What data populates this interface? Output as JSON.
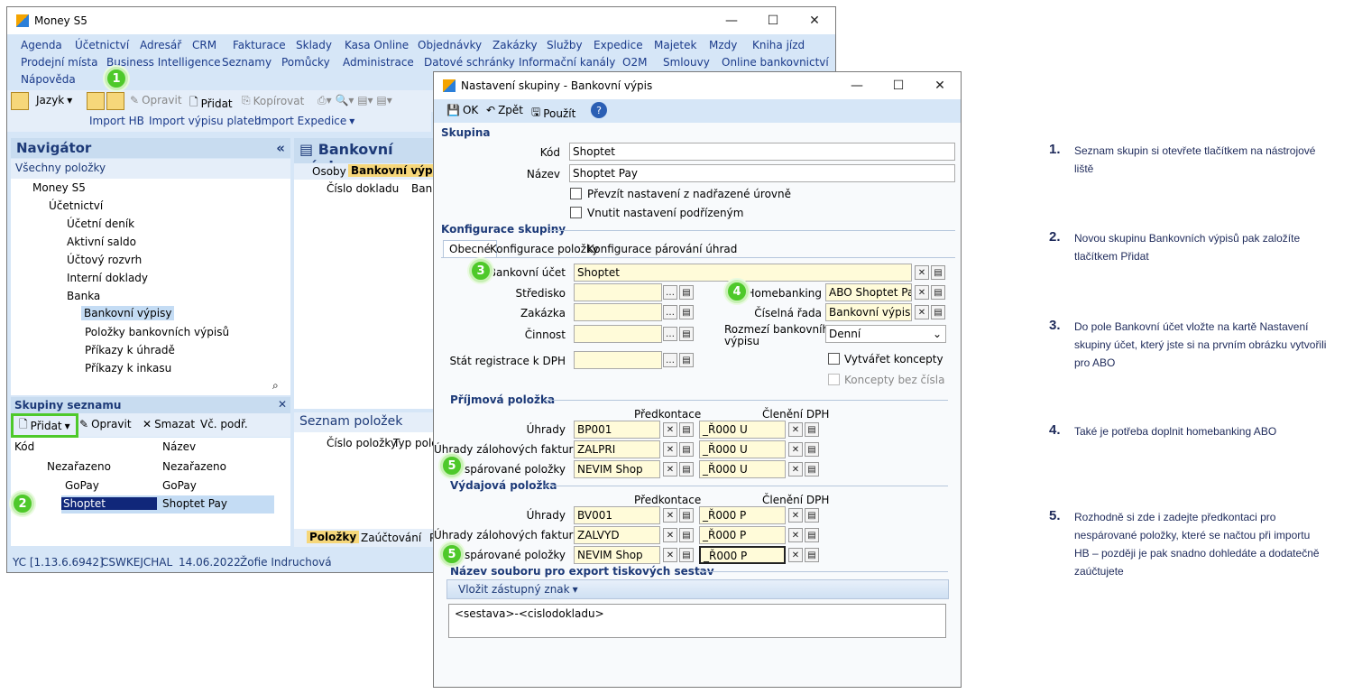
{
  "main": {
    "title": "Money S5",
    "menu_row1": [
      "Agenda",
      "Účetnictví",
      "Adresář",
      "CRM",
      "Fakturace",
      "Sklady",
      "Kasa Online",
      "Objednávky",
      "Zakázky",
      "Služby",
      "Expedice",
      "Majetek",
      "Mzdy",
      "Kniha jízd"
    ],
    "menu_row2": [
      "Prodejní místa",
      "Business Intelligence",
      "Seznamy",
      "Pomůcky",
      "Administrace",
      "Datové schránky",
      "Informační kanály",
      "O2M",
      "Smlouvy",
      "Online bankovnictví"
    ],
    "menu_row3": [
      "Nápověda"
    ],
    "toolbar": {
      "jazyk": "Jazyk",
      "opravit": "Opravit",
      "pridat": "Přidat",
      "kopirovat": "Kopírovat"
    },
    "import_bar": [
      "Import HB",
      "Import výpisu plateb",
      "Import Expedice"
    ],
    "navigator": {
      "title": "Navigátor",
      "all": "Všechny položky",
      "tree": [
        "Money S5",
        "Účetnictví",
        "Účetní deník",
        "Aktivní saldo",
        "Účtový rozvrh",
        "Interní doklady",
        "Banka",
        "Bankovní výpisy",
        "Položky bankovních výpisů",
        "Příkazy k úhradě",
        "Příkazy k inkasu"
      ]
    },
    "groups": {
      "title": "Skupiny seznamu",
      "pridat": "Přidat",
      "opravit": "Opravit",
      "smazat": "Smazat",
      "vc_podr": "Vč. podř.",
      "col_kod": "Kód",
      "col_nazev": "Název",
      "rows": [
        {
          "kod": "Nezařazeno",
          "nazev": "Nezařazeno"
        },
        {
          "kod": "GoPay",
          "nazev": "GoPay"
        },
        {
          "kod": "Shoptet",
          "nazev": "Shoptet Pay"
        }
      ]
    },
    "content": {
      "title": "Bankovní výpisy",
      "tabs": [
        "Osoby",
        "Bankovní výpisy"
      ],
      "col1": "Číslo dokladu",
      "col2": "Bank",
      "sub_title": "Seznam položek",
      "sub_col1": "Číslo položky",
      "sub_col2": "Typ polož",
      "bottom_tabs": [
        "Položky",
        "Zaúčtování",
        "P"
      ]
    },
    "status": [
      "YC [1.13.6.6942]",
      "CSWKEJCHAL",
      "14.06.2022",
      "Žofie Indruchová"
    ]
  },
  "dialog": {
    "title": "Nastavení skupiny - Bankovní výpis",
    "toolbar": {
      "ok": "OK",
      "zpet": "Zpět",
      "pouzit": "Použít"
    },
    "skupina": "Skupina",
    "kod_label": "Kód",
    "kod": "Shoptet",
    "nazev_label": "Název",
    "nazev": "Shoptet Pay",
    "chk1": "Převzít nastavení z nadřazené úrovně",
    "chk2": "Vnutit nastavení podřízeným",
    "konfig": "Konfigurace skupiny",
    "tabs": [
      "Obecné",
      "Konfigurace položky",
      "Konfigurace párování úhrad"
    ],
    "bankovni_ucet_label": "Bankovní účet",
    "bankovni_ucet": "Shoptet",
    "stredisko": "Středisko",
    "zakazka": "Zakázka",
    "cinnost": "Činnost",
    "stat": "Stát registrace k DPH",
    "homebanking_label": "Homebanking",
    "homebanking": "ABO Shoptet Pay",
    "ciselna_label": "Číselná řada",
    "ciselna": "Bankovní výpisy",
    "rozmezi_label1": "Rozmezí bankovního",
    "rozmezi_label2": "výpisu",
    "rozmezi": "Denní",
    "koncepty": "Vytvářet koncepty",
    "koncepty_bez": "Koncepty bez čísla",
    "prijmova": "Příjmová položka",
    "vydajova": "Výdajová položka",
    "predkontace": "Předkontace",
    "cleneni": "Členění DPH",
    "uhrady": "Úhrady",
    "uhrady_zal": "Úhrady zálohových faktur",
    "nesparovane": "Nespárované položky",
    "prij": [
      {
        "p": "BP001",
        "c": "_Ř000 U"
      },
      {
        "p": "ZALPRI",
        "c": "_Ř000 U"
      },
      {
        "p": "NEVIM Shop",
        "c": "_Ř000 U"
      }
    ],
    "vyd": [
      {
        "p": "BV001",
        "c": "_Ř000 P"
      },
      {
        "p": "ZALVYD",
        "c": "_Ř000 P"
      },
      {
        "p": "NEVIM Shop",
        "c": "_Ř000 P"
      }
    ],
    "export": "Název souboru pro export tiskových sestav",
    "vlozit": "Vložit zástupný znak",
    "template": "<sestava>-<cislodokladu>"
  },
  "badges": [
    "1",
    "2",
    "3",
    "4",
    "5",
    "5"
  ],
  "notes": [
    {
      "n": "1.",
      "t": "Seznam skupin si otevřete tlačítkem na nástrojové liště"
    },
    {
      "n": "2.",
      "t": "Novou skupinu Bankovních výpisů pak založíte tlačítkem Přidat"
    },
    {
      "n": "3.",
      "t": "Do pole Bankovní účet vložte na kartě Nastavení skupiny účet, který jste si na prvním obrázku vytvořili pro ABO"
    },
    {
      "n": "4.",
      "t": "Také je potřeba doplnit homebanking ABO"
    },
    {
      "n": "5.",
      "t": "Rozhodně si zde i zadejte předkontaci pro nespárované položky, které se načtou při importu HB – později je pak snadno dohledáte a dodatečně zaúčtujete"
    }
  ]
}
